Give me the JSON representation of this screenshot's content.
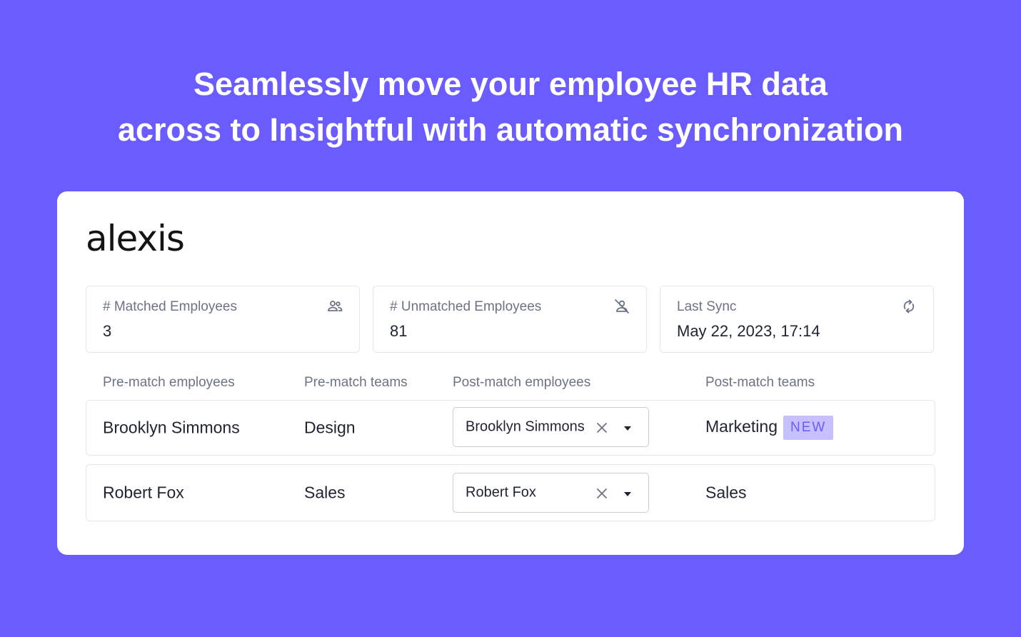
{
  "headline": {
    "line1": "Seamlessly move your employee HR data",
    "line2": "across to Insightful with automatic synchronization"
  },
  "brand": {
    "logo_text": "alexis"
  },
  "stats": [
    {
      "label": "# Matched Employees",
      "value": "3",
      "icon": "people-icon"
    },
    {
      "label": "# Unmatched Employees",
      "value": "81",
      "icon": "person-off-icon"
    },
    {
      "label": "Last Sync",
      "value": "May 22, 2023, 17:14",
      "icon": "sync-icon"
    }
  ],
  "table": {
    "columns": [
      "Pre-match employees",
      "Pre-match teams",
      "Post-match employees",
      "Post-match teams"
    ],
    "rows": [
      {
        "pre_employee": "Brooklyn Simmons",
        "pre_team": "Design",
        "post_employee": "Brooklyn Simmons",
        "post_team": "Marketing",
        "badge": "NEW"
      },
      {
        "pre_employee": "Robert Fox",
        "pre_team": "Sales",
        "post_employee": "Robert Fox",
        "post_team": "Sales"
      }
    ]
  },
  "colors": {
    "background": "#6b5cff",
    "card": "#ffffff",
    "badge_bg": "#c6c0ff",
    "badge_text": "#6b5cff"
  }
}
